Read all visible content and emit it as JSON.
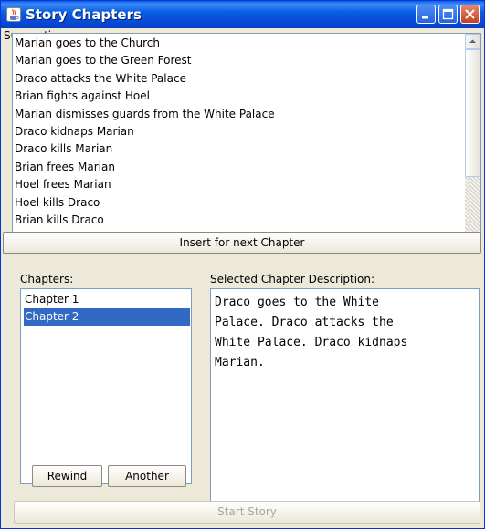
{
  "window": {
    "title": "Story Chapters"
  },
  "suggestions": {
    "label": "Suggestions:",
    "items": [
      "Marian goes to the Church",
      "Marian goes to the Green Forest",
      "Draco attacks the White Palace",
      "Brian fights against Hoel",
      "Marian dismisses guards from the White Palace",
      "Draco kidnaps Marian",
      "Draco kills Marian",
      "Brian frees Marian",
      "Hoel frees Marian",
      "Hoel kills Draco",
      "Brian kills Draco"
    ]
  },
  "insert_button": {
    "label": "Insert for next Chapter"
  },
  "chapters": {
    "label": "Chapters:",
    "items": [
      "Chapter 1",
      "Chapter 2"
    ],
    "selected": "Chapter 2"
  },
  "description": {
    "label": "Selected Chapter Description:",
    "text": "Draco goes to the White\nPalace. Draco attacks the\nWhite Palace. Draco kidnaps\nMarian."
  },
  "rewind_button": {
    "label": "Rewind"
  },
  "another_button": {
    "label": "Another"
  },
  "start_button": {
    "label": "Start Story"
  }
}
